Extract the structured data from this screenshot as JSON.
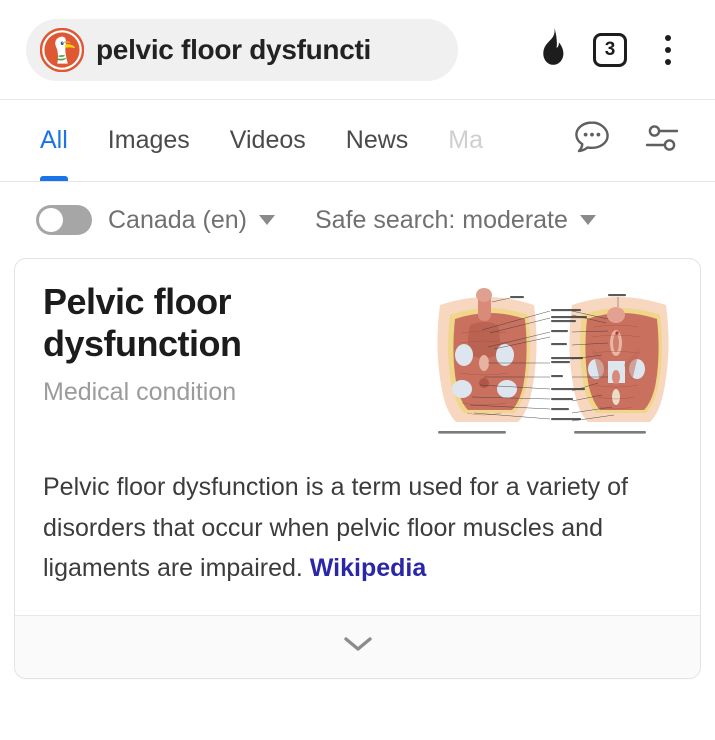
{
  "browser": {
    "omnibox": {
      "query_text": "pelvic floor dysfuncti",
      "logo_icon": "duckduckgo-logo"
    },
    "actions": [
      {
        "name": "fire-button",
        "icon": "flame-icon",
        "label": ""
      },
      {
        "name": "tab-switcher",
        "icon": "tab-count-box-icon",
        "label": "3"
      },
      {
        "name": "browser-menu",
        "icon": "kebab-menu-icon",
        "label": ""
      }
    ]
  },
  "search_tabs": {
    "items": [
      {
        "label": "All",
        "active": true,
        "faded": false
      },
      {
        "label": "Images",
        "active": false,
        "faded": false
      },
      {
        "label": "Videos",
        "active": false,
        "faded": false
      },
      {
        "label": "News",
        "active": false,
        "faded": false
      },
      {
        "label": "Ma",
        "active": false,
        "faded": true
      }
    ],
    "icons": [
      {
        "name": "chat-icon",
        "glyph": "speech-bubble-dots"
      },
      {
        "name": "search-settings-icon",
        "glyph": "sliders"
      }
    ]
  },
  "filters": {
    "toggle": {
      "name": "anonymous-toggle",
      "state": "off"
    },
    "region": {
      "label": "Canada (en)"
    },
    "safe_search": {
      "label": "Safe search: moderate"
    }
  },
  "result_card": {
    "title": "Pelvic floor dysfunction",
    "subtitle": "Medical condition",
    "description_parts": {
      "line1": "Pelvic floor dysfunction",
      "rest": "is a term used for a variety of disorders that occur when pelvic floor muscles and ligaments are impaired.",
      "source_link": "Wikipedia"
    },
    "thumbnail": {
      "name": "pelvic-anatomy-diagram",
      "caption_left": "Male perineal muscles, inferior view",
      "caption_right": "Female perineal muscles, inferior view",
      "labels": [
        "Penis",
        "Bulbospongiosus",
        "Ischiocavernosus / bulbourethral",
        "Urethra",
        "Vagina",
        "Transverse perineal muscles",
        "Anus",
        "External anal sphincter",
        "Levator ani",
        "Coccyx",
        "Gluteus maximus",
        "Clitoris"
      ]
    },
    "expand": {
      "name": "expand-card-button",
      "icon": "chevron-down-icon"
    }
  },
  "colors": {
    "accent_blue": "#1a73e8",
    "link_indigo": "#2a26a8",
    "ddg_orange": "#de5833",
    "bowtie_green": "#4d9e3f"
  }
}
